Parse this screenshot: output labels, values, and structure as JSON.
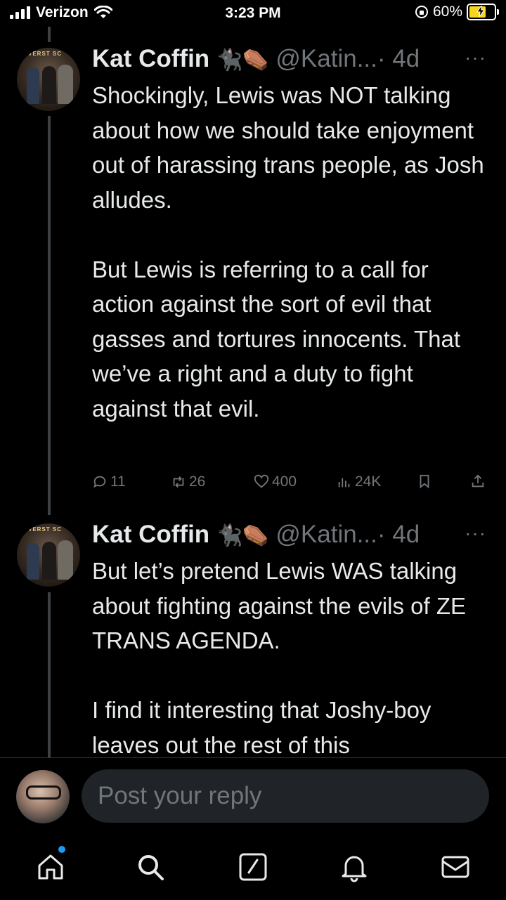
{
  "status_bar": {
    "carrier": "Verizon",
    "time": "3:23 PM",
    "battery": "60%",
    "icons": [
      "signal-icon",
      "wifi-icon",
      "orientation-lock-icon",
      "battery-charging-icon"
    ]
  },
  "tweets": [
    {
      "name": "Kat Coffin",
      "emoji": "🐈‍⬛⚰️",
      "handle": "@Katin...",
      "age": "· 4d",
      "text": "Shockingly, Lewis was NOT talking about how we should take enjoyment out of harassing trans people, as Josh alludes.\n\nBut Lewis is referring to a call for action against the sort of evil that gasses and tortures innocents. That we’ve a right and a duty to fight against that evil.",
      "avatar_sign": "VERST SC",
      "stats": {
        "replies": "11",
        "retweets": "26",
        "likes": "400",
        "views": "24K"
      }
    },
    {
      "name": "Kat Coffin",
      "emoji": "🐈‍⬛⚰️",
      "handle": "@Katin...",
      "age": "· 4d",
      "avatar_sign": "VERST SC",
      "text": "But let’s pretend Lewis WAS talking about fighting against the evils of ZE TRANS AGENDA.\n\nI find it interesting that Joshy-boy leaves out the rest of this"
    }
  ],
  "reply": {
    "placeholder": "Post your reply"
  },
  "tabs": [
    "home-icon",
    "search-icon",
    "compose-icon",
    "notifications-icon",
    "messages-icon"
  ],
  "colors": {
    "accent": "#1d9bf0",
    "muted": "#71767b",
    "text": "#e7e9ea",
    "battery": "#f7d51d"
  }
}
